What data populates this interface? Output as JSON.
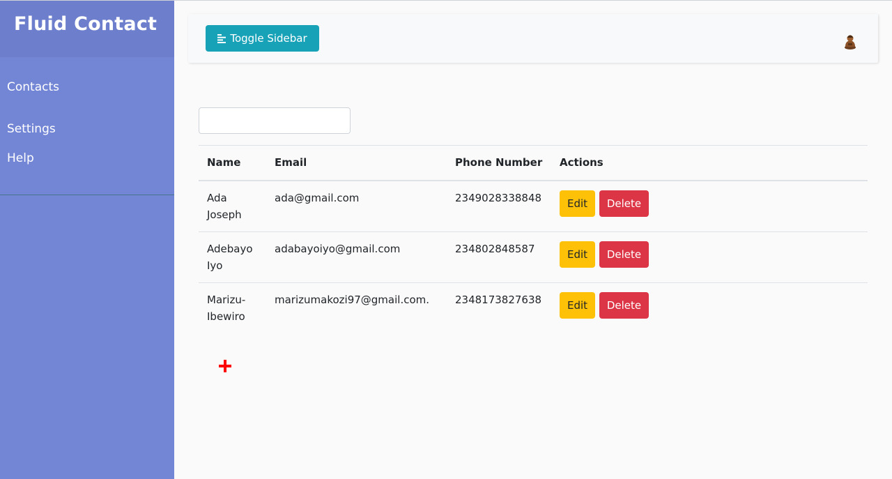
{
  "sidebar": {
    "brand": "Fluid Contact",
    "items": [
      {
        "label": "Contacts"
      },
      {
        "label": "Settings"
      },
      {
        "label": "Help"
      }
    ]
  },
  "navbar": {
    "toggle_label": "Toggle Sidebar",
    "toggle_icon": "align-left-icon",
    "avatar_icon": "avatar-icon"
  },
  "search": {
    "value": "",
    "placeholder": ""
  },
  "table": {
    "headers": [
      "Name",
      "Email",
      "Phone Number",
      "Actions"
    ],
    "rows": [
      {
        "name": "Ada Joseph",
        "email": "ada@gmail.com",
        "phone": "2349028338848"
      },
      {
        "name": "Adebayo Iyo",
        "email": "adabayoiyo@gmail.com",
        "phone": "234802848587"
      },
      {
        "name": "Marizu-Ibewiro",
        "email": "marizumakozi97@gmail.com.",
        "phone": "2348173827638"
      }
    ],
    "edit_label": "Edit",
    "delete_label": "Delete"
  },
  "add_icon": "plus-icon",
  "colors": {
    "sidebar": "#7386d5",
    "sidebar_header": "#6d7fcc",
    "toggle": "#17a2b8",
    "edit": "#ffc107",
    "delete": "#dc3545",
    "add": "#ff0000"
  }
}
